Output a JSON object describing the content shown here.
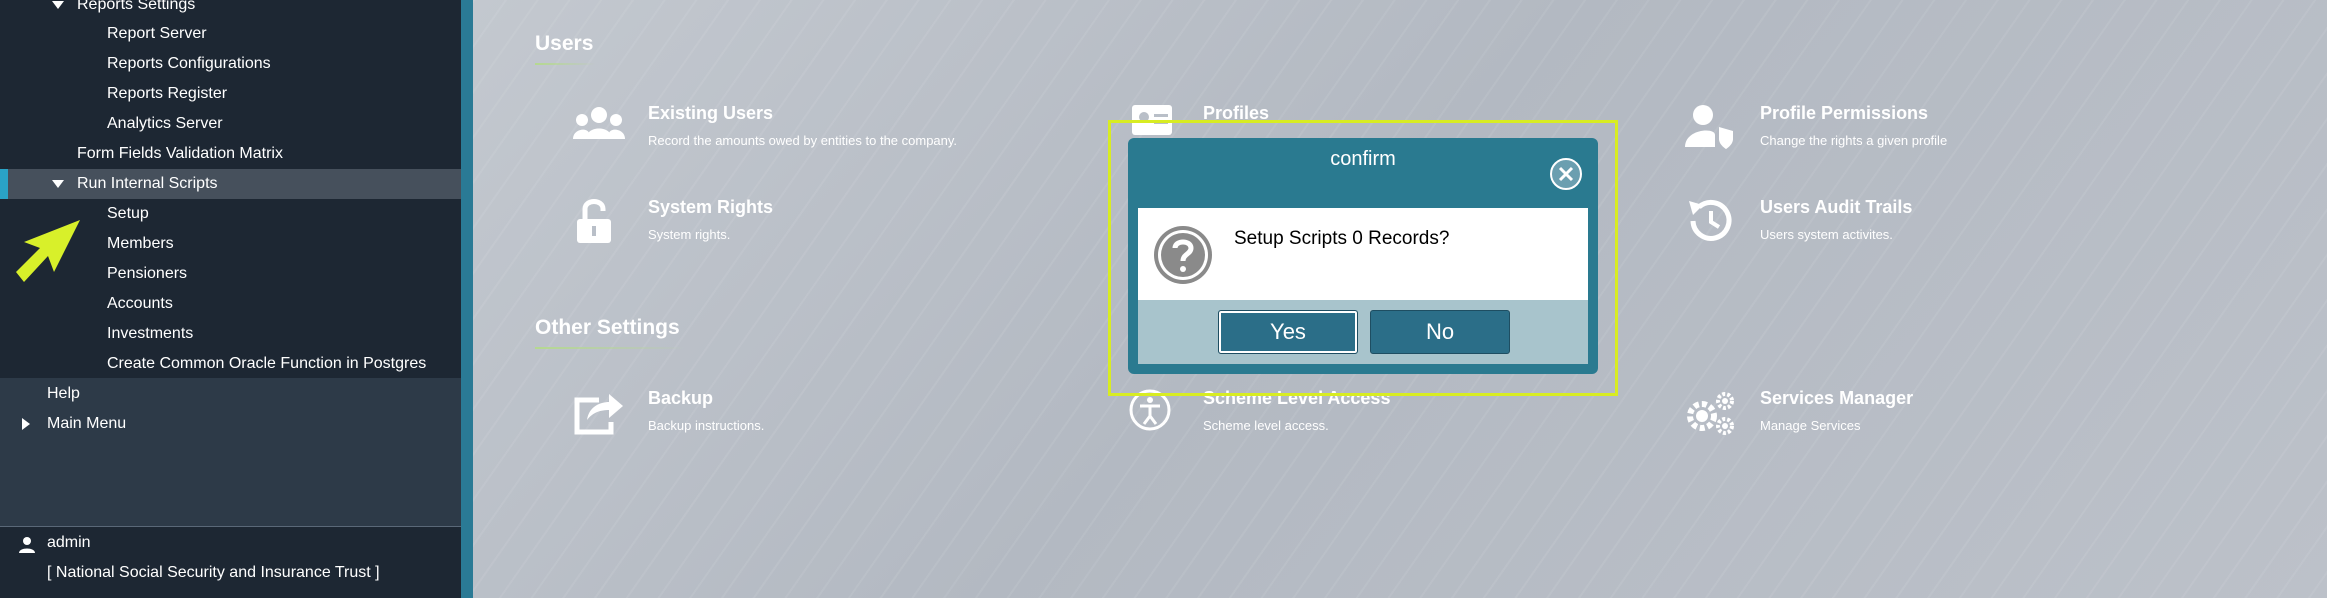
{
  "sidebar": {
    "items": [
      {
        "label": "Reports Settings"
      },
      {
        "label": "Report Server"
      },
      {
        "label": "Reports Configurations"
      },
      {
        "label": "Reports Register"
      },
      {
        "label": "Analytics Server"
      },
      {
        "label": "Form Fields Validation Matrix"
      },
      {
        "label": "Run Internal Scripts"
      },
      {
        "label": "Setup"
      },
      {
        "label": "Members"
      },
      {
        "label": "Pensioners"
      },
      {
        "label": "Accounts"
      },
      {
        "label": "Investments"
      },
      {
        "label": "Create Common Oracle Function in Postgres"
      },
      {
        "label": "Help"
      },
      {
        "label": "Main Menu"
      }
    ],
    "user": {
      "name": "admin",
      "organization": "[ National Social Security and Insurance Trust ]"
    }
  },
  "main": {
    "sections": [
      {
        "title": "Users",
        "tiles": [
          {
            "title": "Existing Users",
            "desc": "Record the amounts owed by entities to the company.",
            "icon": "users-group-icon"
          },
          {
            "title": "Profiles",
            "desc": "",
            "icon": "profiles-icon"
          },
          {
            "title": "Profile Permissions",
            "desc": "Change the rights a given profile",
            "icon": "user-shield-icon"
          },
          {
            "title": "System Rights",
            "desc": "System rights.",
            "icon": "unlock-icon"
          },
          {
            "title": "Users Audit Trails",
            "desc": "Users system activites.",
            "icon": "history-icon"
          }
        ]
      },
      {
        "title": "Other Settings",
        "tiles": [
          {
            "title": "Backup",
            "desc": "Backup instructions.",
            "icon": "share-export-icon"
          },
          {
            "title": "Scheme Level Access",
            "desc": "Scheme level access.",
            "icon": "accessibility-icon"
          },
          {
            "title": "Services Manager",
            "desc": "Manage Services",
            "icon": "gears-icon"
          }
        ]
      }
    ]
  },
  "dialog": {
    "title": "confirm",
    "message": "Setup Scripts 0 Records?",
    "yes_label": "Yes",
    "no_label": "No"
  },
  "colors": {
    "sidebar_bg": "#1d2733",
    "accent": "#2a7a95",
    "dialog_header": "#2a7a90",
    "highlight": "#d8ec22"
  }
}
